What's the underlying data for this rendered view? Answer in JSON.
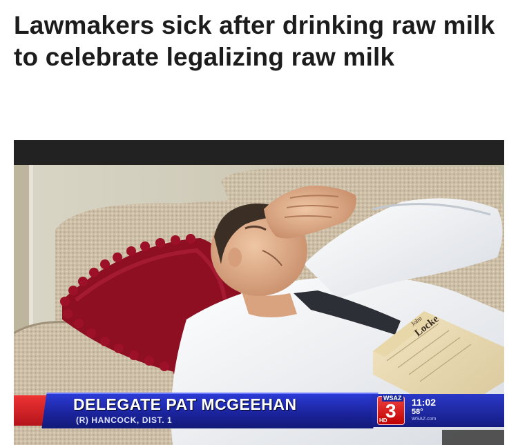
{
  "headline": "Lawmakers sick after drinking raw milk to celebrate legalizing raw milk",
  "photo": {
    "book_title": "Locke",
    "book_author": "John",
    "lower_third": {
      "name": "DELEGATE PAT MCGEEHAN",
      "subtitle": "(R) HANCOCK, DIST. 1",
      "station_call": "WSAZ",
      "channel_number": "3",
      "hd_label": "HD",
      "time": "11:02",
      "temperature": "58°",
      "website": "WSAZ.com"
    }
  },
  "colors": {
    "headline_text": "#1c1c1c",
    "lower_third_blue": "#1a2298",
    "lower_third_red": "#c81a22",
    "photo_top_band": "#222222"
  }
}
